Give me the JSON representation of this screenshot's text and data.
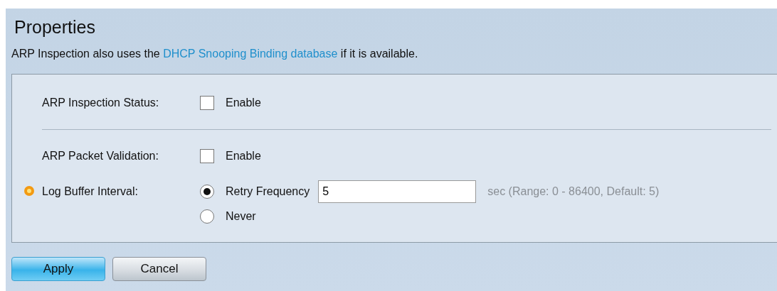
{
  "title": "Properties",
  "description": {
    "before": "ARP Inspection also uses the ",
    "link": "DHCP Snooping Binding database",
    "after": " if it is available."
  },
  "inspection_status": {
    "label": "ARP Inspection Status:",
    "option": "Enable",
    "checked": false
  },
  "packet_validation": {
    "label": "ARP Packet Validation:",
    "option": "Enable",
    "checked": false
  },
  "log_buffer_interval": {
    "label": "Log Buffer Interval:",
    "required": true,
    "options": [
      {
        "label": "Retry Frequency",
        "selected": true,
        "value": "5",
        "hint": "sec (Range: 0 - 86400, Default: 5)"
      },
      {
        "label": "Never",
        "selected": false
      }
    ]
  },
  "buttons": [
    {
      "label": "Apply",
      "kind": "primary"
    },
    {
      "label": "Cancel",
      "kind": "secondary"
    }
  ]
}
